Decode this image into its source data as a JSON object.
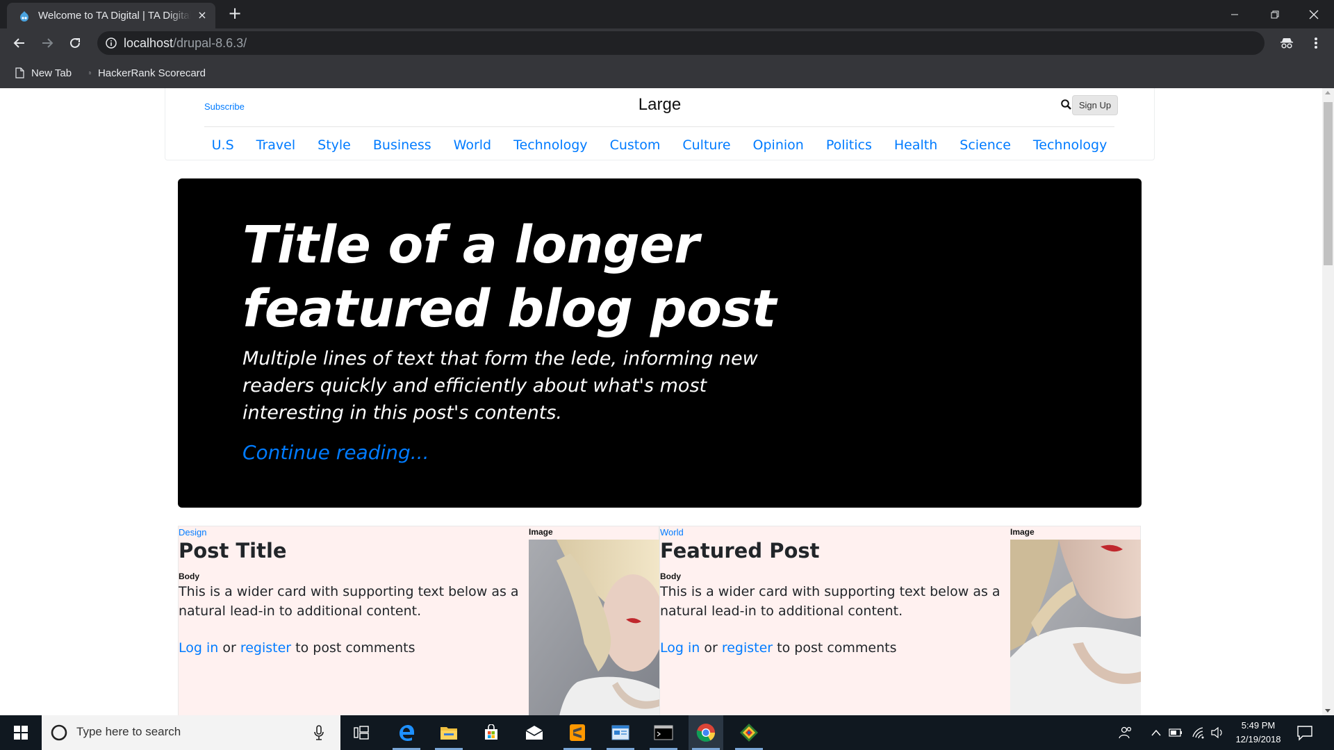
{
  "browser": {
    "tab_title": "Welcome to TA Digital | TA Digital",
    "tab_close": "×",
    "new_tab": "+",
    "url_host": "localhost",
    "url_path": "/drupal-8.6.3/",
    "bookmarks": [
      "New Tab",
      "HackerRank Scorecard"
    ]
  },
  "header": {
    "subscribe": "Subscribe",
    "brand": "Large",
    "signup": "Sign Up",
    "nav": [
      "U.S",
      "Travel",
      "Style",
      "Business",
      "World",
      "Technology",
      "Custom",
      "Culture",
      "Opinion",
      "Politics",
      "Health",
      "Science",
      "Technology"
    ]
  },
  "featured": {
    "title": "Title of a longer featured blog post",
    "lede": "Multiple lines of text that form the lede, informing new readers quickly and efficiently about what's most interesting in this post's contents.",
    "continue": "Continue reading..."
  },
  "cards": [
    {
      "category": "Design",
      "title": "Post Title",
      "body_label": "Body",
      "body": "This is a wider card with supporting text below as a natural lead-in to additional content.",
      "login": "Log in",
      "or": "or",
      "register": "register",
      "suffix": "to post comments",
      "image_label": "Image"
    },
    {
      "category": "World",
      "title": "Featured Post",
      "body_label": "Body",
      "body": "This is a wider card with supporting text below as a natural lead-in to additional content.",
      "login": "Log in",
      "or": "or",
      "register": "register",
      "suffix": "to post comments",
      "image_label": "Image"
    }
  ],
  "taskbar": {
    "search_placeholder": "Type here to search",
    "time": "5:49 PM",
    "date": "12/19/2018"
  },
  "colors": {
    "link": "#007bff",
    "chrome_dark": "#202124",
    "chrome_toolbar": "#35363a",
    "card_bg": "#fff1f0",
    "jumbotron_bg": "#000000",
    "taskbar_bg": "#101820"
  }
}
